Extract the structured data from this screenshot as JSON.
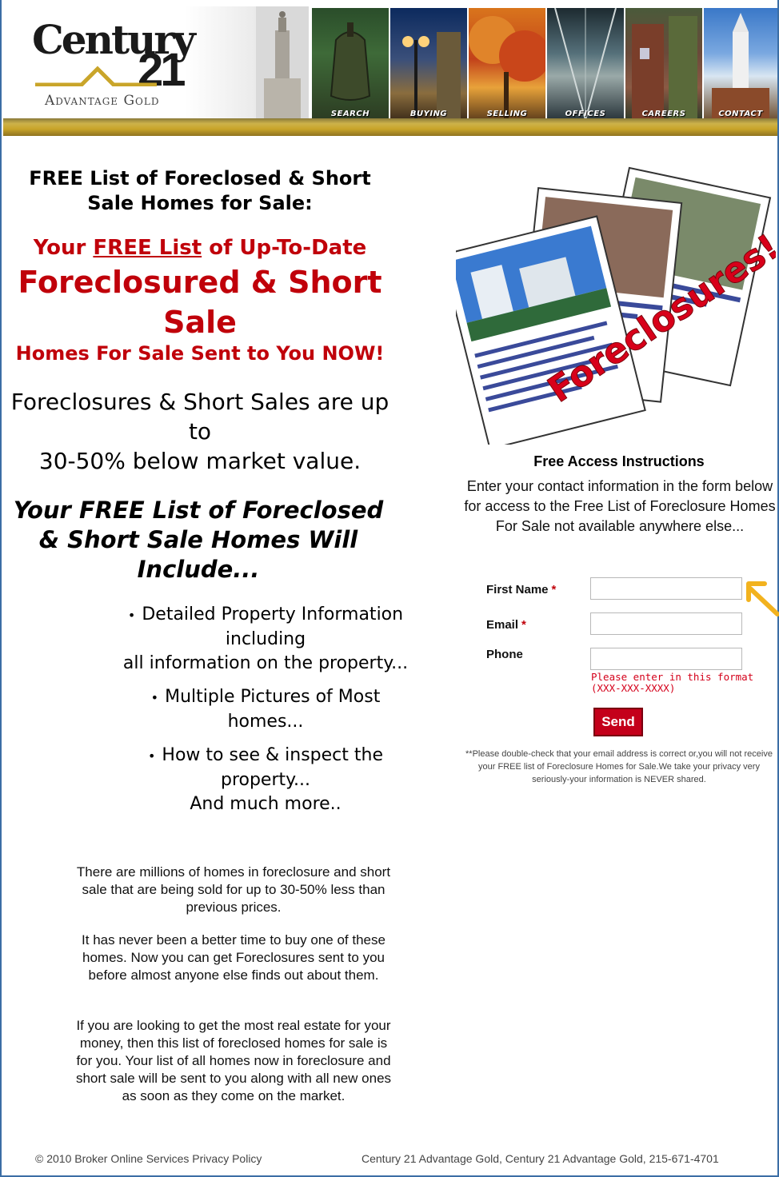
{
  "header": {
    "logo_word": "Century",
    "logo_number": "21",
    "logo_subtitle": "Advantage Gold",
    "nav": [
      "SEARCH",
      "BUYING",
      "SELLING",
      "OFFICES",
      "CAREERS",
      "CONTACT"
    ]
  },
  "left": {
    "headline": "FREE List of Foreclosed & Short Sale Homes for Sale:",
    "sub1_pre": "Your ",
    "sub1_link": "FREE List",
    "sub1_post": " of Up-To-Date",
    "sub2": "Foreclosured & Short Sale",
    "sub3": "Homes For Sale Sent to You NOW!",
    "pct_line1": "Foreclosures & Short Sales are up to",
    "pct_line2": "30-50% below market value.",
    "include_title": "Your FREE List of Foreclosed & Short Sale Homes Will Include...",
    "bullets": [
      "Detailed Property Information including",
      "all information on the property...",
      "Multiple Pictures of Most homes...",
      "How to see & inspect the property...",
      "And much more.."
    ],
    "paragraphs": [
      "There are millions of homes in foreclosure and short sale that are being sold for up to 30-50% less than previous prices.",
      "It has never been a better time to buy one of these homes. Now you can get Foreclosures sent to you before almost anyone else finds out about them.",
      "If you are looking to get the most real estate for your money, then this list of foreclosed homes for sale is for you. Your list of all homes now in foreclosure and short sale will be sent to you along with all new ones as soon as they come on the market."
    ]
  },
  "right": {
    "flyer_text": "Foreclosures!",
    "access_title": "Free Access Instructions",
    "access_body": "Enter your contact information in the form below for access to the Free List of Foreclosure Homes For Sale not available anywhere else...",
    "form": {
      "first_name_label": "First Name",
      "email_label": "Email",
      "phone_label": "Phone",
      "required_mark": "*",
      "first_name_value": "",
      "email_value": "",
      "phone_value": "",
      "phone_hint": "Please enter in this format (XXX-XXX-XXXX)",
      "send_label": "Send"
    },
    "disclaimer": "**Please double-check that your email address is correct or,you will not receive your FREE list of Foreclosure Homes for Sale.We take your privacy very seriously-your information is NEVER shared."
  },
  "footer": {
    "left": "© 2010 Broker Online Services Privacy Policy",
    "right": "Century 21 Advantage Gold, Century 21 Advantage Gold, 215-671-4701"
  },
  "colors": {
    "accent_red": "#c0000a",
    "gold": "#c9a52a",
    "border_blue": "#3b6ea5"
  }
}
